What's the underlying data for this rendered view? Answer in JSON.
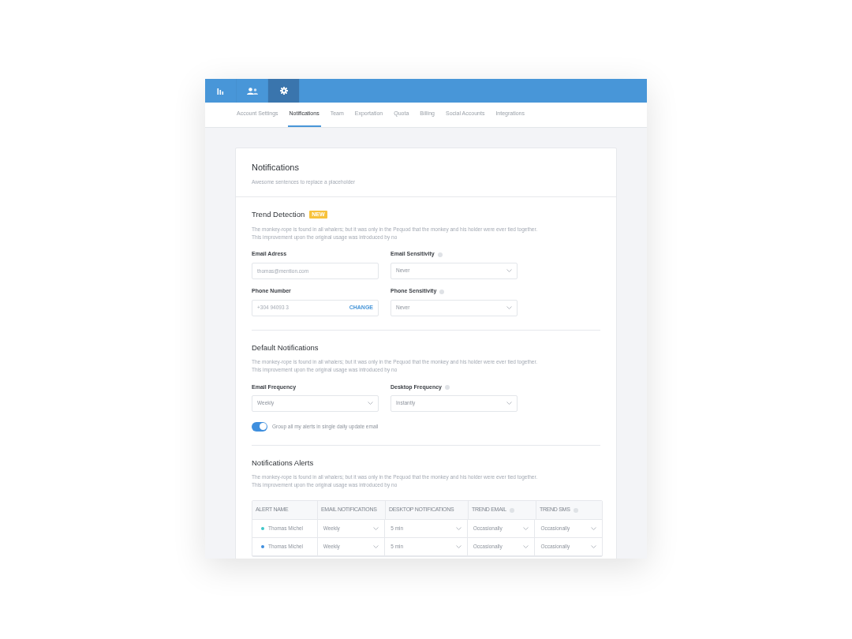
{
  "icon_tabs": [
    {
      "kind": "chart",
      "selected": false
    },
    {
      "kind": "users",
      "selected": false
    },
    {
      "kind": "settings",
      "selected": true
    }
  ],
  "nav_tabs": [
    {
      "label": "Account Settings",
      "selected": false
    },
    {
      "label": "Notifications",
      "selected": true
    },
    {
      "label": "Team",
      "selected": false
    },
    {
      "label": "Exportation",
      "selected": false
    },
    {
      "label": "Quota",
      "selected": false
    },
    {
      "label": "Billing",
      "selected": false
    },
    {
      "label": "Social Accounts",
      "selected": false
    },
    {
      "label": "Integrations",
      "selected": false
    }
  ],
  "header": {
    "title": "Notifications",
    "subtitle": "Awesome sentences to replace a placeholder"
  },
  "sections": [
    {
      "title": "Trend Detection",
      "badge": "NEW",
      "description": [
        "The monkey-rope is found in all whalers; but it was only in the Pequod that the monkey and his holder were ever tied together.",
        "This improvement upon the original usage was introduced by no"
      ],
      "fields": [
        {
          "kind": "text",
          "label": "Email Adress",
          "info": false,
          "placeholder": "thomas@mention.com"
        },
        {
          "kind": "select",
          "label": "Email Sensitivity",
          "info": true,
          "value": "Never"
        },
        {
          "kind": "phone",
          "label": "Phone Number",
          "info": false,
          "placeholder": "+304 94093 3",
          "action": "CHANGE"
        },
        {
          "kind": "select",
          "label": "Phone Sensitivity",
          "info": true,
          "value": "Never"
        }
      ]
    },
    {
      "title": "Default Notifications",
      "description": [
        "The monkey-rope is found in all whalers; but it was only in the Pequod that the monkey and his holder were ever tied together.",
        "This improvement upon the original usage was introduced by no"
      ],
      "fields": [
        {
          "kind": "select",
          "label": "Email Frequency",
          "info": false,
          "value": "Weekly"
        },
        {
          "kind": "select",
          "label": "Desktop Frequency",
          "info": true,
          "value": "Instantly"
        }
      ],
      "toggle": {
        "label": "Group all my alerts in single daily update email",
        "on": true
      }
    },
    {
      "title": "Notifications Alerts",
      "description": [
        "The monkey-rope is found in all whalers; but it was only in the Pequod that the monkey and his holder were ever tied together.",
        "This improvement upon the original usage was introduced by no"
      ],
      "table": {
        "columns": [
          {
            "label": "ALERT NAME",
            "info": false
          },
          {
            "label": "EMAIL NOTIFICATIONS",
            "info": false
          },
          {
            "label": "DESKTOP NOTIFICATIONS",
            "info": false
          },
          {
            "label": "TREND EMAIL",
            "info": true
          },
          {
            "label": "TREND SMS",
            "info": true
          }
        ],
        "rows": [
          {
            "color": "#3ec7c9",
            "cells": [
              "Thomas Michel",
              "Weekly",
              "5 min",
              "Occasionally",
              "Occasionally"
            ]
          },
          {
            "color": "#3f8fde",
            "cells": [
              "Thomas Michel",
              "Weekly",
              "5 min",
              "Occasionally",
              "Occasionally"
            ]
          }
        ]
      }
    }
  ]
}
